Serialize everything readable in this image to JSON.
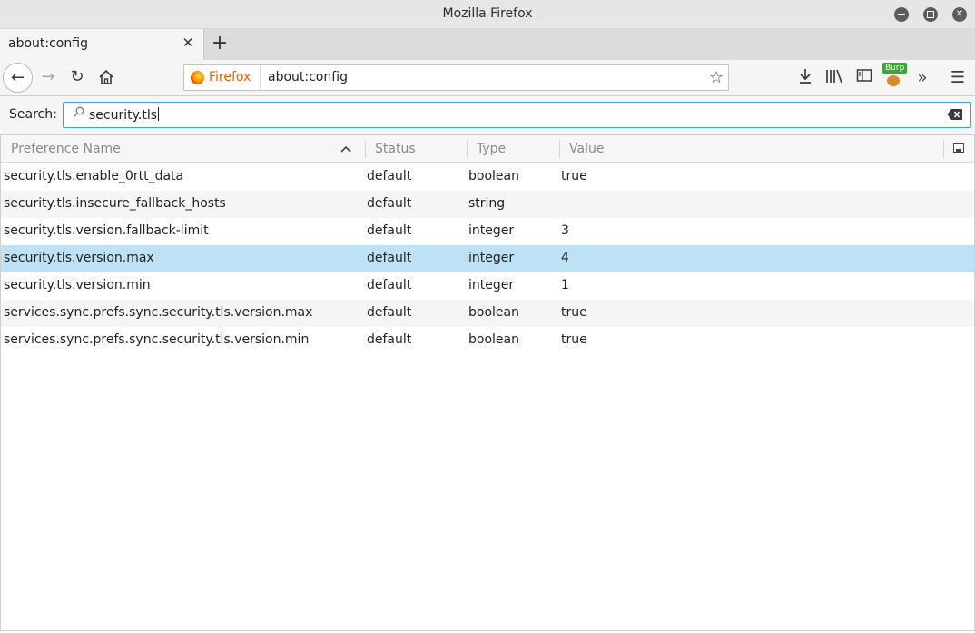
{
  "window": {
    "title": "Mozilla Firefox"
  },
  "tabs": [
    {
      "label": "about:config"
    }
  ],
  "urlbar": {
    "identity_label": "Firefox",
    "url": "about:config"
  },
  "toolbar": {
    "burp_badge": "Burp"
  },
  "search": {
    "label": "Search:",
    "value": "security.tls"
  },
  "table": {
    "columns": [
      "Preference Name",
      "Status",
      "Type",
      "Value"
    ],
    "rows": [
      {
        "name": "security.tls.enable_0rtt_data",
        "status": "default",
        "type": "boolean",
        "value": "true"
      },
      {
        "name": "security.tls.insecure_fallback_hosts",
        "status": "default",
        "type": "string",
        "value": ""
      },
      {
        "name": "security.tls.version.fallback-limit",
        "status": "default",
        "type": "integer",
        "value": "3"
      },
      {
        "name": "security.tls.version.max",
        "status": "default",
        "type": "integer",
        "value": "4"
      },
      {
        "name": "security.tls.version.min",
        "status": "default",
        "type": "integer",
        "value": "1"
      },
      {
        "name": "services.sync.prefs.sync.security.tls.version.max",
        "status": "default",
        "type": "boolean",
        "value": "true"
      },
      {
        "name": "services.sync.prefs.sync.security.tls.version.min",
        "status": "default",
        "type": "boolean",
        "value": "true"
      }
    ],
    "selected_row": 3
  },
  "colors": {
    "selection": "#bde1f5",
    "focus_border": "#3d9ee6",
    "identity": "#e66000"
  }
}
